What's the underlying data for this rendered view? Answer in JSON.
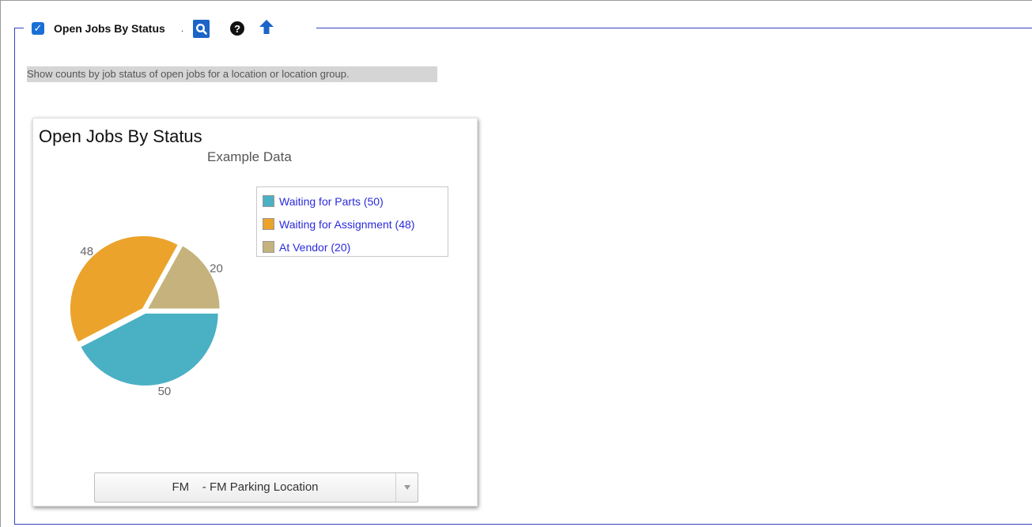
{
  "section": {
    "checked": true,
    "title": "Open Jobs By Status",
    "dot": ".",
    "description": "Show counts by job status of open jobs for a location or location group."
  },
  "icons": {
    "preview": "search-preview-icon",
    "help": "help-icon",
    "move_up": "arrow-up-icon",
    "help_glyph": "?"
  },
  "widget": {
    "title": "Open Jobs By Status",
    "subtitle": "Example Data",
    "location_select": {
      "selected": "FM    - FM Parking Location"
    }
  },
  "chart_data": {
    "type": "pie",
    "title": "Open Jobs By Status",
    "subtitle": "Example Data",
    "legend_position": "top-right",
    "slices": [
      {
        "label": "Waiting for Parts",
        "value": 50,
        "legend": "Waiting for Parts (50)",
        "color": "#4ab0c4"
      },
      {
        "label": "Waiting for Assignment",
        "value": 48,
        "legend": "Waiting for Assignment (48)",
        "color": "#eba32b"
      },
      {
        "label": "At Vendor",
        "value": 20,
        "legend": "At Vendor (20)",
        "color": "#c6b27c"
      }
    ]
  },
  "colors": {
    "border_accent": "#3344bb",
    "checkbox": "#1a6fd6",
    "legend_text": "#2a2add"
  }
}
